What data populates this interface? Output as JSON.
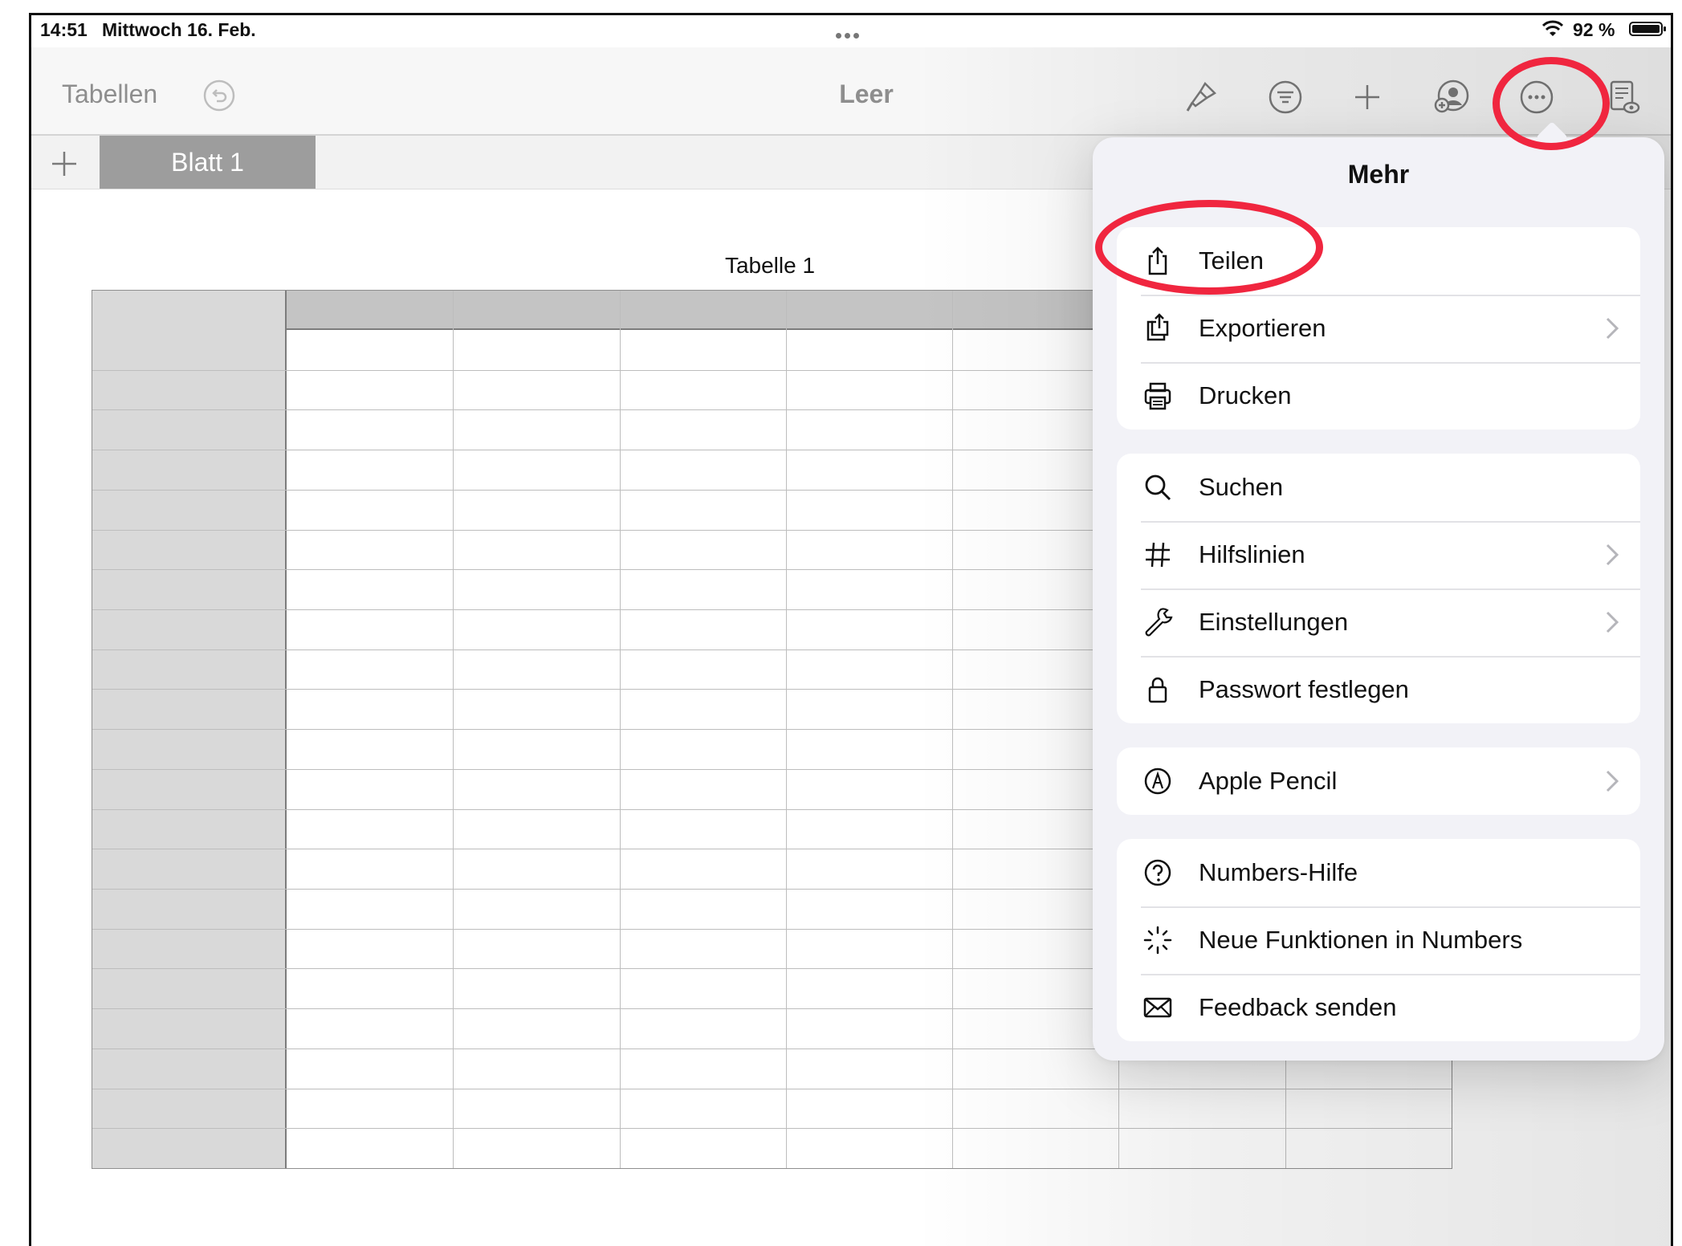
{
  "status_bar": {
    "time": "14:51",
    "date": "Mittwoch 16. Feb.",
    "battery": "92 %",
    "battery_level": 0.92
  },
  "toolbar": {
    "back_label": "Tabellen",
    "document_title": "Leer",
    "icons": [
      "undo-icon",
      "paintbrush-icon",
      "filter-icon",
      "plus-icon",
      "collaborate-icon",
      "more-icon",
      "reader-view-icon"
    ]
  },
  "sheets": {
    "tabs": [
      {
        "label": "Blatt 1",
        "selected": true
      }
    ]
  },
  "table": {
    "title": "Tabelle 1",
    "columns": 7,
    "rows": 21
  },
  "more_menu": {
    "title": "Mehr",
    "groups": [
      [
        {
          "label": "Teilen",
          "icon": "share-icon",
          "chevron": false
        },
        {
          "label": "Exportieren",
          "icon": "export-icon",
          "chevron": true
        },
        {
          "label": "Drucken",
          "icon": "print-icon",
          "chevron": false
        }
      ],
      [
        {
          "label": "Suchen",
          "icon": "search-icon",
          "chevron": false
        },
        {
          "label": "Hilfslinien",
          "icon": "grid-lines-icon",
          "chevron": true
        },
        {
          "label": "Einstellungen",
          "icon": "wrench-icon",
          "chevron": true
        },
        {
          "label": "Passwort festlegen",
          "icon": "lock-icon",
          "chevron": false
        }
      ],
      [
        {
          "label": "Apple Pencil",
          "icon": "pencil-icon",
          "chevron": true
        }
      ],
      [
        {
          "label": "Numbers-Hilfe",
          "icon": "help-icon",
          "chevron": false
        },
        {
          "label": "Neue Funktionen in Numbers",
          "icon": "sparkle-icon",
          "chevron": false
        },
        {
          "label": "Feedback senden",
          "icon": "mail-icon",
          "chevron": false
        }
      ]
    ]
  },
  "colors": {
    "highlight_ring": "#f0263f",
    "menu_background": "#f2f2f7",
    "tab_selected": "#9d9d9d"
  }
}
